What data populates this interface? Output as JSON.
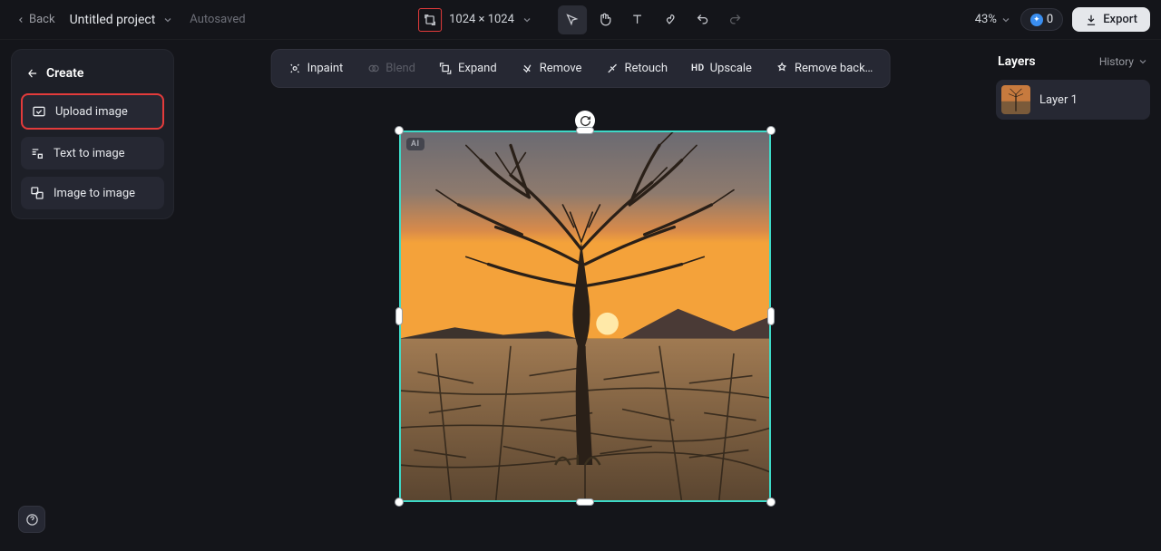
{
  "header": {
    "back_label": "Back",
    "project_name": "Untitled project",
    "autosaved_label": "Autosaved",
    "dimensions": "1024 × 1024",
    "zoom": "43%",
    "credits": "0",
    "export_label": "Export"
  },
  "sidebar": {
    "create_label": "Create",
    "items": [
      {
        "label": "Upload image",
        "icon": "upload-image-icon",
        "highlighted": true
      },
      {
        "label": "Text to image",
        "icon": "text-to-image-icon",
        "highlighted": false
      },
      {
        "label": "Image to image",
        "icon": "image-to-image-icon",
        "highlighted": false
      }
    ]
  },
  "action_bar": {
    "items": [
      {
        "label": "Inpaint",
        "icon": "inpaint-icon",
        "disabled": false
      },
      {
        "label": "Blend",
        "icon": "blend-icon",
        "disabled": true
      },
      {
        "label": "Expand",
        "icon": "expand-icon",
        "disabled": false
      },
      {
        "label": "Remove",
        "icon": "remove-icon",
        "disabled": false
      },
      {
        "label": "Retouch",
        "icon": "retouch-icon",
        "disabled": false
      },
      {
        "label": "Upscale",
        "icon": "upscale-icon",
        "disabled": false
      },
      {
        "label": "Remove back…",
        "icon": "remove-bg-icon",
        "disabled": false
      }
    ]
  },
  "canvas": {
    "ai_badge": "AI"
  },
  "layers": {
    "title": "Layers",
    "history_label": "History",
    "items": [
      {
        "name": "Layer 1"
      }
    ]
  }
}
